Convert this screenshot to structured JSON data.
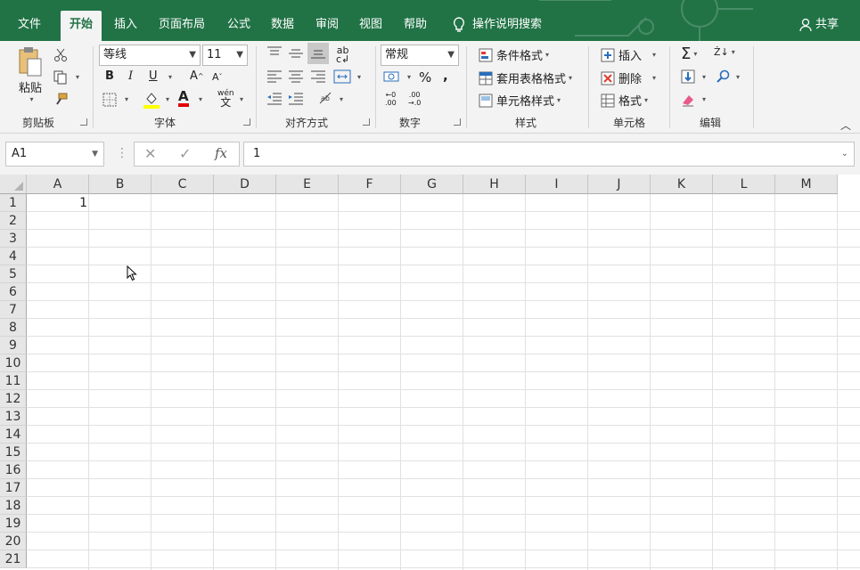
{
  "tabs": [
    "文件",
    "开始",
    "插入",
    "页面布局",
    "公式",
    "数据",
    "审阅",
    "视图",
    "帮助"
  ],
  "active_tab": "开始",
  "tell_me": "操作说明搜索",
  "share": "共享",
  "colors": {
    "brand": "#217346",
    "ribbon_bg": "#f3f3f3"
  },
  "clipboard": {
    "paste": "粘贴",
    "group": "剪贴板"
  },
  "font": {
    "name": "等线",
    "size": "11",
    "group": "字体",
    "bold": "B",
    "italic": "I",
    "underline": "U",
    "grow": "A",
    "shrink": "A",
    "font_color": "A",
    "phonetic": "wén"
  },
  "alignment": {
    "group": "对齐方式"
  },
  "number": {
    "format": "常规",
    "group": "数字",
    "percent": "%",
    "comma": ","
  },
  "styles": {
    "conditional": "条件格式",
    "table": "套用表格格式",
    "cell": "单元格样式",
    "group": "样式"
  },
  "cells": {
    "insert": "插入",
    "delete": "删除",
    "format": "格式",
    "group": "单元格"
  },
  "editing": {
    "sum": "Σ",
    "group": "编辑"
  },
  "namebox": "A1",
  "formula_fx": "fx",
  "formula": "1",
  "columns": [
    "A",
    "B",
    "C",
    "D",
    "E",
    "F",
    "G",
    "H",
    "I",
    "J",
    "K",
    "L",
    "M"
  ],
  "rows": [
    "1",
    "2",
    "3",
    "4",
    "5",
    "6",
    "7",
    "8",
    "9",
    "10",
    "11",
    "12",
    "13",
    "14",
    "15",
    "16",
    "17",
    "18",
    "19",
    "20",
    "21"
  ],
  "cell_A1": "1"
}
